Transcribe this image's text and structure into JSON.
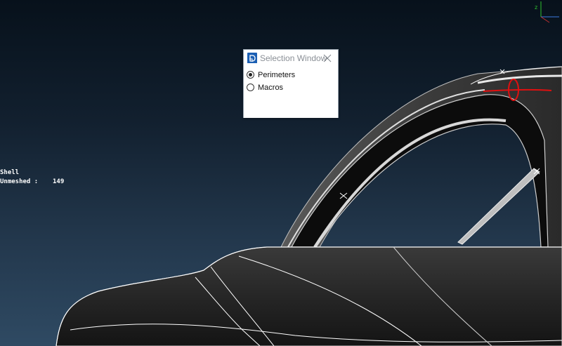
{
  "viewport": {
    "info_lines": [
      {
        "label": "Shell",
        "value": ""
      },
      {
        "label": "Unmeshed :",
        "value": "149"
      }
    ],
    "axis_labels": {
      "z": "z"
    },
    "colors": {
      "background_top": "#07111b",
      "background_bottom": "#2f4a63",
      "mesh_line": "#ffffff",
      "annotation": "#e01010"
    }
  },
  "dialog": {
    "title": "Selection Window",
    "app_icon": "app-logo-icon",
    "close_icon": "close-icon",
    "options": [
      {
        "label": "Perimeters",
        "selected": true
      },
      {
        "label": "Macros",
        "selected": false
      }
    ]
  }
}
